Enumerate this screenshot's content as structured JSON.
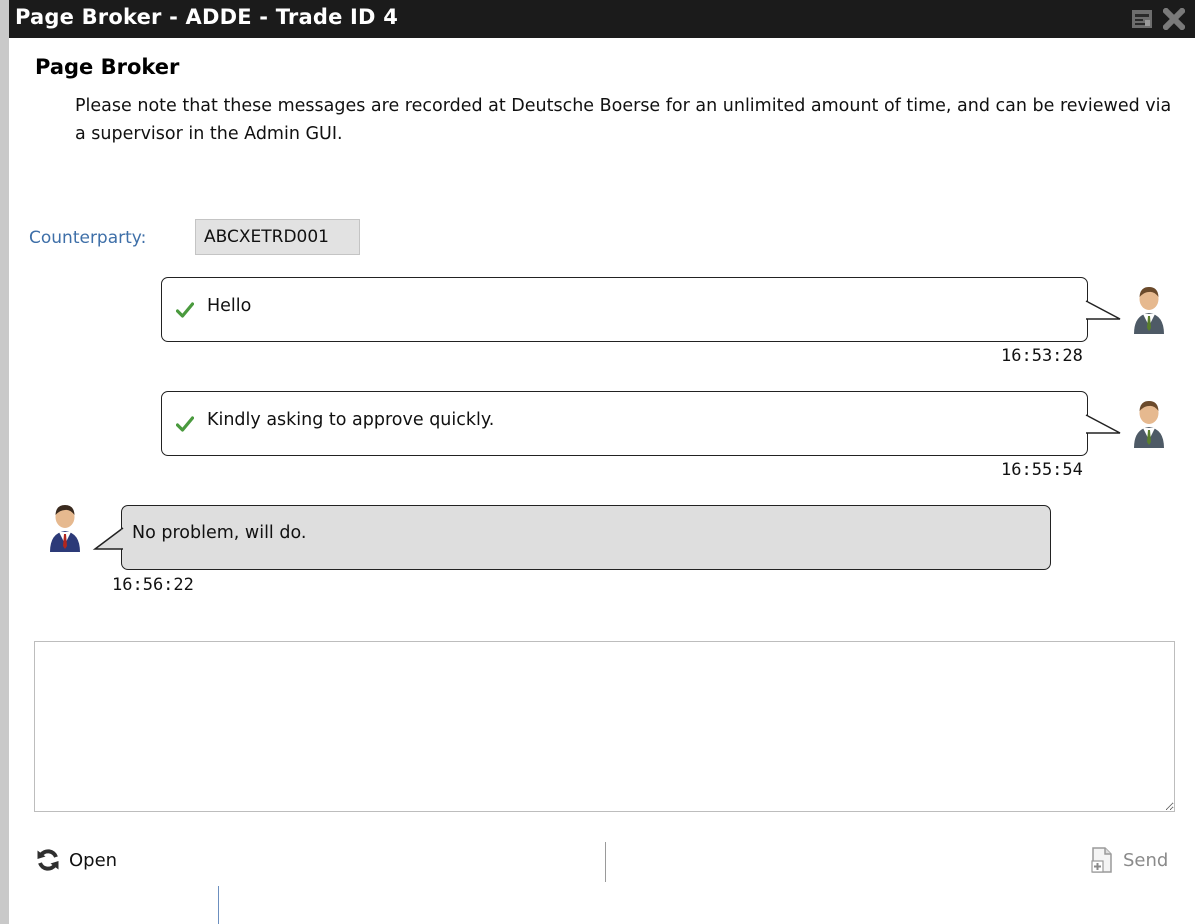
{
  "window": {
    "title": "Page Broker - ADDE - Trade ID 4",
    "controls": [
      "restore-icon",
      "close-icon"
    ]
  },
  "page": {
    "heading": "Page Broker",
    "notice": "Please note that these messages are recorded at Deutsche Boerse for an unlimited amount of time, and can be reviewed via a supervisor in the Admin GUI."
  },
  "counterparty": {
    "label": "Counterparty:",
    "value": "ABCXETRD001"
  },
  "messages": [
    {
      "direction": "outgoing",
      "text": "Hello",
      "time": "16:53:28",
      "status_icon": "check-icon"
    },
    {
      "direction": "outgoing",
      "text": "Kindly asking to approve quickly.",
      "time": "16:55:54",
      "status_icon": "check-icon"
    },
    {
      "direction": "incoming",
      "text": "No problem, will do.",
      "time": "16:56:22"
    }
  ],
  "compose": {
    "value": "",
    "placeholder": ""
  },
  "actions": {
    "open_label": "Open",
    "send_label": "Send"
  },
  "colors": {
    "titlebar_bg": "#1b1b1b",
    "label_blue": "#3e6fa8",
    "check_green": "#4a9a3e",
    "incoming_bubble_bg": "#dedede"
  }
}
